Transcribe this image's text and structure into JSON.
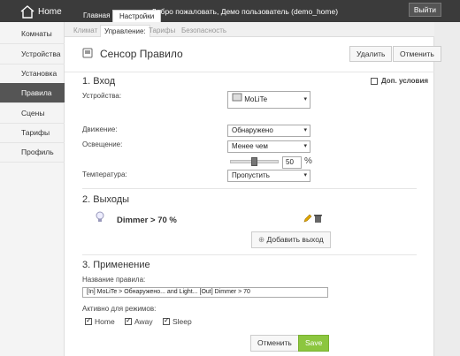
{
  "app": {
    "title": "Home"
  },
  "main_tabs": [
    {
      "label": "Главная",
      "active": false
    },
    {
      "label": "Настройки",
      "active": true
    }
  ],
  "welcome_text": "Добро пожаловать, Демо пользователь (demo_home)",
  "logout_label": "Выйти",
  "sidebar": {
    "items": [
      {
        "label": "Комнаты",
        "active": false
      },
      {
        "label": "Устройства",
        "active": false
      },
      {
        "label": "Установка",
        "active": false
      },
      {
        "label": "Правила",
        "active": true
      },
      {
        "label": "Сцены",
        "active": false
      },
      {
        "label": "Тарифы",
        "active": false
      },
      {
        "label": "Профиль",
        "active": false
      }
    ]
  },
  "sub_tabs": [
    {
      "label": "Климат",
      "active": false
    },
    {
      "label": "Управление:",
      "active": true
    },
    {
      "label": "Тарифы",
      "active": false
    },
    {
      "label": "Безопасность",
      "active": false
    }
  ],
  "header": {
    "title": "Сенсор Правило",
    "delete_label": "Удалить",
    "cancel_label": "Отменить"
  },
  "input_section": {
    "title": "1. Вход",
    "extra_conditions_label": "Доп. условия",
    "extra_conditions_checked": false,
    "devices_label": "Устройства:",
    "device_name": "MoLiTe",
    "motion_label": "Движение:",
    "motion_value": "Обнаружено",
    "light_label": "Освещение:",
    "light_value": "Менее чем",
    "light_level": "50",
    "light_level_fraction": 0.5,
    "percent_sign": "%",
    "temperature_label": "Температура:",
    "temperature_value": "Пропустить"
  },
  "output_section": {
    "title": "2. Выходы",
    "output_text": "Dimmer > 70 %",
    "add_output_label": "Добавить выход"
  },
  "apply_section": {
    "title": "3. Применение",
    "rule_name_label": "Название правила:",
    "rule_name_value": "[In] MoLiTe > Обнаружено... and Light... [Out] Dimmer > 70",
    "modes_label": "Активно для режимов:",
    "modes": [
      {
        "label": "Home",
        "checked": true
      },
      {
        "label": "Away",
        "checked": true
      },
      {
        "label": "Sleep",
        "checked": true
      }
    ],
    "cancel_label": "Отменить",
    "save_label": "Save"
  },
  "colors": {
    "topbar": "#3b3b3b",
    "sidebar_active": "#555555",
    "save_button": "#8cc63f"
  },
  "icons": [
    "home-icon",
    "sensor-icon",
    "device-icon",
    "lightbulb-icon",
    "edit-icon",
    "trash-icon",
    "plus-icon",
    "chevron-down-icon"
  ]
}
